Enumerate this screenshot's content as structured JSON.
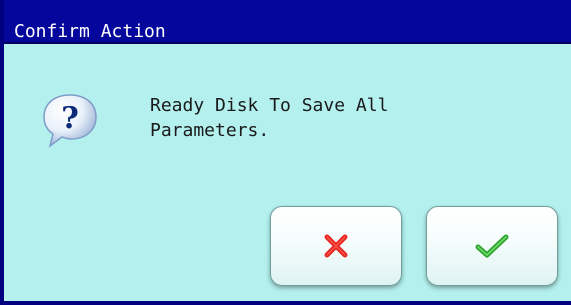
{
  "dialog": {
    "title": "Confirm Action",
    "message": "Ready Disk To Save All\nParameters.",
    "icon": "question-icon",
    "buttons": {
      "cancel": {
        "icon": "cross-icon",
        "color": "#e52420"
      },
      "confirm": {
        "icon": "check-icon",
        "color": "#35c232"
      }
    }
  },
  "colors": {
    "titlebar": "#04069c",
    "body": "#b3f0ee",
    "frame": "#000080"
  }
}
